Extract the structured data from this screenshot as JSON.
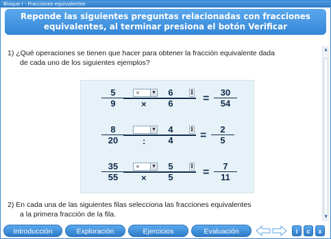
{
  "window": {
    "title": "Bloque I  -  Fracciones equivalentes"
  },
  "header": {
    "line1": "Reponde las siguientes preguntas relacionadas con fracciones",
    "line2": "equivalentes, al terminar presiona el botón Verificar"
  },
  "question1": {
    "line1": "1) ¿Qué operaciones se tienen que hacer para obtener la fracción equivalente dada",
    "line2": "de cada uno de los siguientes ejemplos?"
  },
  "examples": [
    {
      "a_num": "5",
      "a_den": "9",
      "select_value": "×",
      "operator": "×",
      "b_num": "6",
      "b_den": "6",
      "equals": "=",
      "c_num": "30",
      "c_den": "54"
    },
    {
      "a_num": "8",
      "a_den": "20",
      "select_value": "",
      "operator": ":",
      "b_num": "4",
      "b_den": "4",
      "equals": "=",
      "c_num": "2",
      "c_den": "5"
    },
    {
      "a_num": "35",
      "a_den": "55",
      "select_value": "×",
      "operator": "×",
      "b_num": "5",
      "b_den": "5",
      "equals": "=",
      "c_num": "7",
      "c_den": "11"
    }
  ],
  "question2": {
    "line1": "2) En cada una de las siguientes filas selecciona las fracciones equivalentes",
    "line2": "a la primera fracción de la fila."
  },
  "nav": {
    "tabs": [
      "Introducción",
      "Exploración",
      "Ejercicios",
      "Evaluación"
    ],
    "icons": {
      "back": "arrow-left-icon",
      "forward": "arrow-right-icon"
    },
    "info_label": "i",
    "credits_label": "c",
    "close_label": "x"
  },
  "colors": {
    "accent": "#3586d6",
    "panel": "#e6f2f7",
    "text": "#0f2a4a"
  }
}
